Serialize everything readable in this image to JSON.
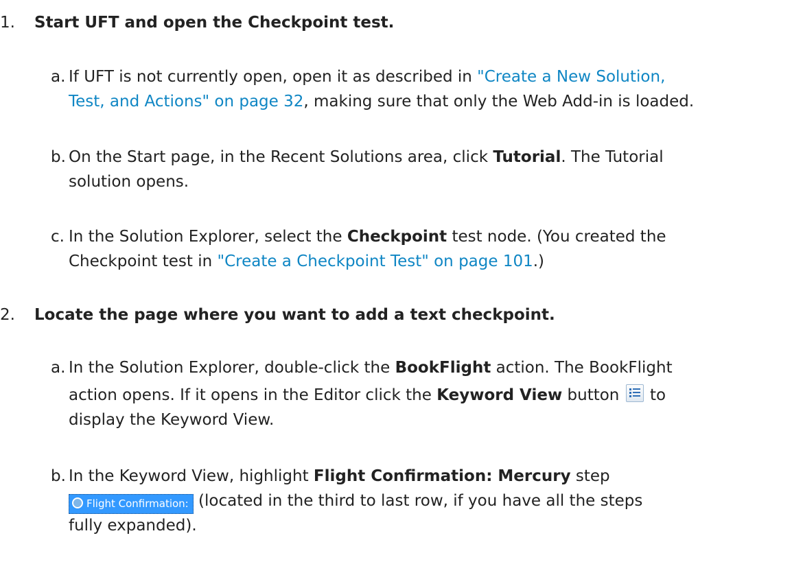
{
  "steps": [
    {
      "number": "1.",
      "title": "Start UFT and open the Checkpoint test."
    },
    {
      "number": "2.",
      "title": "Locate the page where you want to add a text checkpoint."
    }
  ],
  "s1a": {
    "letter": "a.",
    "t1": "If UFT is not currently open, open it as described in ",
    "link1": "\"Create a New Solution,",
    "link2": "Test, and Actions\" on page 32",
    "t2": ", making sure that only the Web Add-in is loaded."
  },
  "s1b": {
    "letter": "b.",
    "t1": "On the Start page, in the Recent Solutions area, click ",
    "b1": "Tutorial",
    "t2": ". The Tutorial",
    "t3": "solution opens."
  },
  "s1c": {
    "letter": "c.",
    "t1": "In the Solution Explorer, select the ",
    "b1": "Checkpoint",
    "t2": " test node. (You created the",
    "t3": "Checkpoint test in ",
    "link1": "\"Create a Checkpoint Test\" on page 101",
    "t4": ".)"
  },
  "s2a": {
    "letter": "a.",
    "t1": "In the Solution Explorer, double-click the ",
    "b1": "BookFlight",
    "t2": " action. The BookFlight",
    "t3": "action opens. If it opens in the Editor click the ",
    "b2": "Keyword View",
    "t4": " button ",
    "t5": " to",
    "t6": "display the Keyword View.",
    "icon": "keyword-view-icon"
  },
  "s2b": {
    "letter": "b.",
    "t1": "In the Keyword View, highlight ",
    "b1": "Flight Confirmation: Mercury",
    "t2": " step",
    "chip_label": "Flight Confirmation:",
    "t3": " (located in the third to last row, if you have all the steps",
    "t4": "fully expanded).",
    "icon": "magnifier-icon",
    "chip_color": "#3399ff"
  },
  "link_color": "#0f86c4"
}
